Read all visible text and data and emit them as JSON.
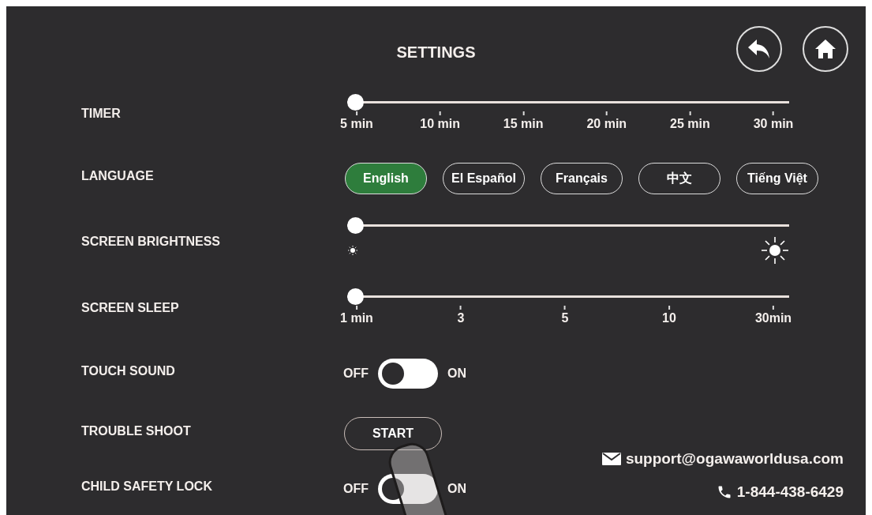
{
  "title": "SETTINGS",
  "rows": [
    {
      "kind": "slider",
      "label": "TIMER",
      "level": 0,
      "ticks": [
        "5 min",
        "10 min",
        "15 min",
        "20 min",
        "25 min",
        "30 min"
      ]
    },
    {
      "kind": "choices",
      "label": "LANGUAGE",
      "options": [
        {
          "label": "English",
          "selected": true
        },
        {
          "label": "El Español",
          "selected": false
        },
        {
          "label": "Français",
          "selected": false
        },
        {
          "label": "中文",
          "selected": false
        },
        {
          "label": "Tiếng Việt",
          "selected": false
        }
      ]
    },
    {
      "kind": "brightness",
      "label": "SCREEN BRIGHTNESS",
      "level": 0
    },
    {
      "kind": "slider",
      "label": "SCREEN SLEEP",
      "level": 0,
      "ticks": [
        "1 min",
        "3",
        "5",
        "10",
        "30min"
      ]
    },
    {
      "kind": "toggle",
      "label": "TOUCH SOUND",
      "off": "OFF",
      "on_label": "ON",
      "on": false
    },
    {
      "kind": "button",
      "label": "TROUBLE SHOOT",
      "button": "START"
    },
    {
      "kind": "toggle",
      "label": "CHILD SAFETY LOCK",
      "off": "OFF",
      "on_label": "ON",
      "on": false
    }
  ],
  "contact": {
    "email": "support@ogawaworldusa.com",
    "phone": "1-844-438-6429"
  }
}
